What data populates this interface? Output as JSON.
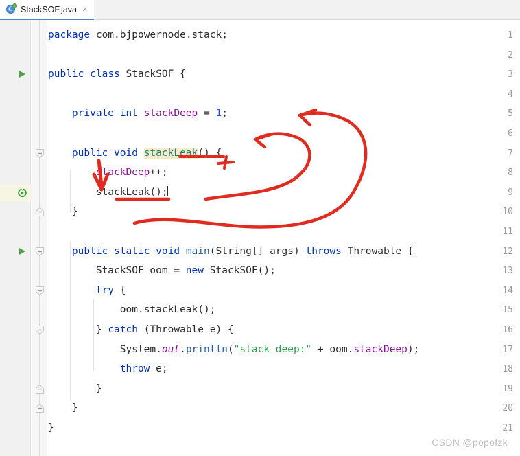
{
  "window": {
    "title": "StackSOF.java"
  },
  "tab": {
    "label": "StackSOF.java",
    "close_label": "×",
    "icon_letter": "C",
    "icon_name": "java-class-icon",
    "accent_color": "#4a86c8"
  },
  "editor": {
    "language": "java",
    "current_line": 9,
    "highlighted_identifier": "stackLeak",
    "highlight_color": "#f4ecc8",
    "current_line_color": "#fbfbef",
    "gutter": {
      "line_numbers": [
        1,
        2,
        3,
        4,
        5,
        6,
        7,
        8,
        9,
        10,
        11,
        12,
        13,
        14,
        15,
        16,
        17,
        18,
        19,
        20,
        21
      ],
      "run_markers": [
        3,
        12
      ],
      "recursion_markers": [
        9
      ],
      "fold_markers": [
        {
          "line": 7,
          "state": "expanded-start"
        },
        {
          "line": 10,
          "state": "expanded-end"
        },
        {
          "line": 12,
          "state": "expanded-start"
        },
        {
          "line": 14,
          "state": "expanded-start"
        },
        {
          "line": 16,
          "state": "expanded-start"
        },
        {
          "line": 19,
          "state": "expanded-end"
        },
        {
          "line": 20,
          "state": "expanded-end"
        }
      ]
    },
    "lines": [
      {
        "n": 1,
        "text": "package com.bjpowernode.stack;"
      },
      {
        "n": 2,
        "text": ""
      },
      {
        "n": 3,
        "text": "public class StackSOF {"
      },
      {
        "n": 4,
        "text": ""
      },
      {
        "n": 5,
        "text": "    private int stackDeep = 1;"
      },
      {
        "n": 6,
        "text": ""
      },
      {
        "n": 7,
        "text": "    public void stackLeak() {"
      },
      {
        "n": 8,
        "text": "        stackDeep++;"
      },
      {
        "n": 9,
        "text": "        stackLeak();"
      },
      {
        "n": 10,
        "text": "    }"
      },
      {
        "n": 11,
        "text": ""
      },
      {
        "n": 12,
        "text": "    public static void main(String[] args) throws Throwable {"
      },
      {
        "n": 13,
        "text": "        StackSOF oom = new StackSOF();"
      },
      {
        "n": 14,
        "text": "        try {"
      },
      {
        "n": 15,
        "text": "            oom.stackLeak();"
      },
      {
        "n": 16,
        "text": "        } catch (Throwable e) {"
      },
      {
        "n": 17,
        "text": "            System.out.println(\"stack deep:\" + oom.stackDeep);"
      },
      {
        "n": 18,
        "text": "            throw e;"
      },
      {
        "n": 19,
        "text": "        }"
      },
      {
        "n": 20,
        "text": "    }"
      },
      {
        "n": 21,
        "text": "}"
      }
    ]
  },
  "annotations": {
    "color": "#e02b20",
    "items": [
      {
        "name": "arrow-to-stackdeep-declaration",
        "kind": "curved-arrow"
      },
      {
        "name": "arrow-to-stackleak-signature",
        "kind": "curved-arrow"
      },
      {
        "name": "underline-stackleak-signature",
        "kind": "underline"
      },
      {
        "name": "underline-stackleak-call",
        "kind": "underline"
      },
      {
        "name": "plus-mark",
        "kind": "mark"
      },
      {
        "name": "down-arrow-to-recursive-call",
        "kind": "down-arrow"
      },
      {
        "name": "loop-curve",
        "kind": "curve"
      }
    ]
  },
  "watermark": {
    "text": "CSDN @popofzk"
  }
}
